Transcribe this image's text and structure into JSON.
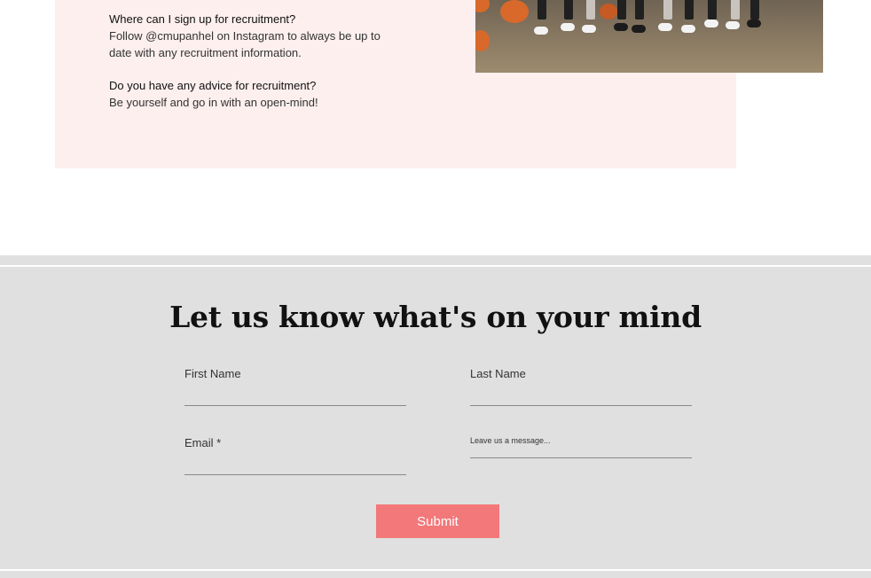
{
  "faq": {
    "items": [
      {
        "question": "Where can I sign up for recruitment?",
        "answer": "Follow @cmupanhel on Instagram to always be up to date with any recruitment information."
      },
      {
        "question": "Do you have any advice for recruitment?",
        "answer": "Be yourself and go in with an open-mind!"
      }
    ]
  },
  "contact": {
    "heading": "Let us know what's on your mind",
    "first_name_label": "First Name",
    "last_name_label": "Last Name",
    "email_label": "Email *",
    "message_placeholder": "Leave us a message...",
    "submit_label": "Submit"
  },
  "colors": {
    "faq_background": "#fcefee",
    "contact_background": "#e0e0e0",
    "submit_button": "#f2787a"
  }
}
